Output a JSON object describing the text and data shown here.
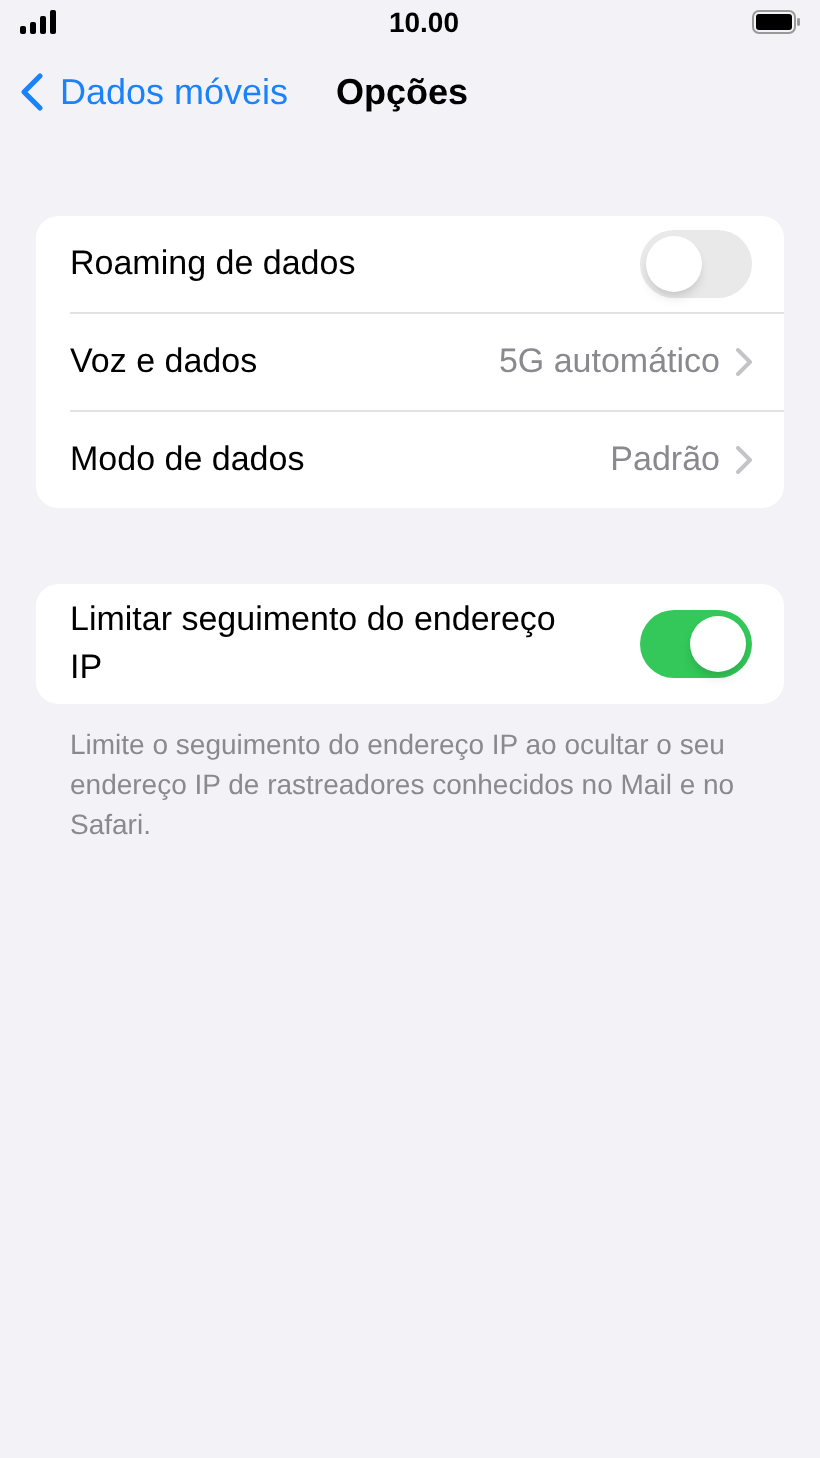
{
  "status_bar": {
    "time": "10.00"
  },
  "nav": {
    "back": "Dados móveis",
    "title": "Opções"
  },
  "groups": [
    {
      "rows": [
        {
          "kind": "toggle",
          "label": "Roaming de dados",
          "on": false
        },
        {
          "kind": "link",
          "label": "Voz e dados",
          "value": "5G automático"
        },
        {
          "kind": "link",
          "label": "Modo de dados",
          "value": "Padrão"
        }
      ]
    },
    {
      "rows": [
        {
          "kind": "toggle",
          "label": "Limitar seguimento do endereço IP",
          "on": true
        }
      ],
      "footer": "Limite o seguimento do endereço IP ao ocultar o seu endereço IP de rastreadores conhecidos no Mail e no Safari."
    }
  ]
}
